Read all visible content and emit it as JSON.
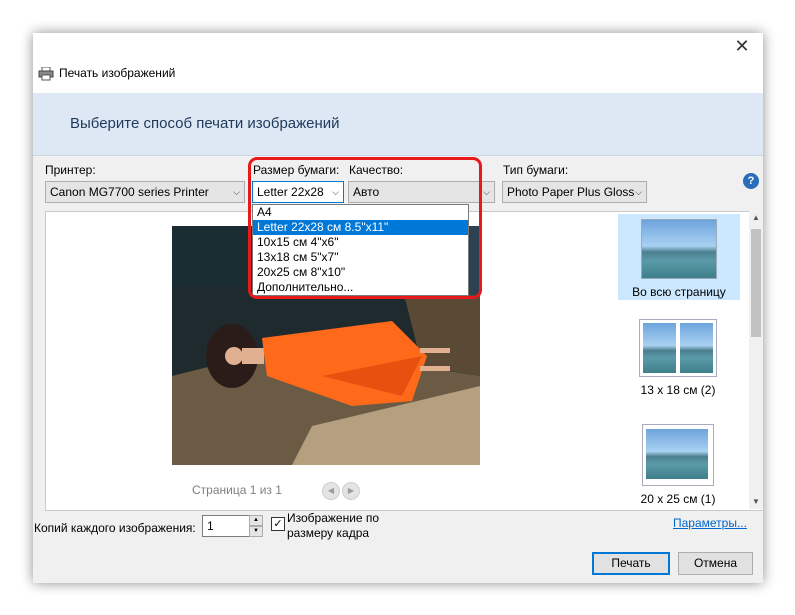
{
  "window": {
    "title": "Печать изображений",
    "close_glyph": "✕"
  },
  "banner": {
    "heading": "Выберите способ печати изображений"
  },
  "printer": {
    "label": "Принтер:",
    "value": "Canon MG7700 series Printer"
  },
  "paper_size": {
    "label": "Размер бумаги:",
    "value": "Letter 22x28",
    "options": [
      "A4",
      "Letter 22x28 см 8.5\"x11\"",
      "10x15 см 4\"x6\"",
      "13x18 см 5\"x7\"",
      "20x25 см 8\"x10\"",
      "Дополнительно..."
    ],
    "selected_index": 1
  },
  "quality": {
    "label": "Качество:",
    "value": "Авто"
  },
  "paper_type": {
    "label": "Тип бумаги:",
    "value": "Photo Paper Plus Gloss"
  },
  "help": {
    "glyph": "?"
  },
  "preview": {
    "page_indicator": "Страница 1 из 1"
  },
  "layouts": [
    {
      "label": "Во всю страницу",
      "selected": true
    },
    {
      "label": "13 x 18 см (2)",
      "selected": false
    },
    {
      "label": "20 x 25 см (1)",
      "selected": false
    }
  ],
  "copies": {
    "label": "Копий каждого изображения:",
    "value": "1"
  },
  "fit": {
    "label": "Изображение по размеру кадра",
    "checked": true
  },
  "options_link": "Параметры...",
  "buttons": {
    "print": "Печать",
    "cancel": "Отмена"
  },
  "colors": {
    "highlight": "#e8191a",
    "selection": "#0078d7",
    "banner": "#dde8f4",
    "link": "#0066cc"
  },
  "icons": [
    "printer-icon",
    "close-icon",
    "help-icon",
    "chevron-down-icon",
    "arrow-left-icon",
    "arrow-right-icon",
    "checkmark-icon"
  ]
}
